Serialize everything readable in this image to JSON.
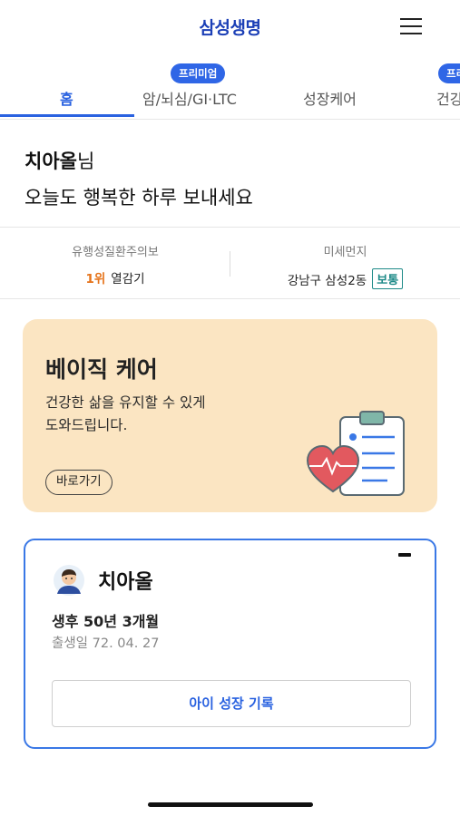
{
  "header": {
    "title": "삼성생명",
    "menu_icon": "hamburger-menu-icon"
  },
  "tabs": [
    {
      "label": "홈",
      "active": true,
      "badge": ""
    },
    {
      "label": "암/뇌심/GI·LTC",
      "active": false,
      "badge": "프리미엄"
    },
    {
      "label": "성장케어",
      "active": false,
      "badge": ""
    },
    {
      "label": "건강",
      "active": false,
      "badge": "프리"
    }
  ],
  "greeting": {
    "name": "치아올",
    "suffix": "님",
    "message": "오늘도 행복한 하루 보내세요"
  },
  "info": {
    "disease": {
      "label": "유행성질환주의보",
      "rank": "1위",
      "value": "열감기"
    },
    "dust": {
      "label": "미세먼지",
      "location": "강남구 삼성2동",
      "status": "보통"
    }
  },
  "care_card": {
    "title": "베이직 케어",
    "description": "건강한 삶을 유지할 수 있게 도와드립니다.",
    "button": "바로가기",
    "illustration_icon": "clipboard-heart-icon"
  },
  "child_card": {
    "name": "치아올",
    "age": "생후 50년 3개월",
    "birth": "출생일 72. 04. 27",
    "button": "아이 성장 기록",
    "avatar_icon": "child-avatar-icon"
  },
  "colors": {
    "brand": "#1b3fb6",
    "accent": "#2a62e0",
    "badge": "#2f66e6",
    "rank": "#e5731a",
    "air_ok": "#1e8a88",
    "care_bg": "#fbe5c2",
    "card_border": "#3a78e6"
  }
}
